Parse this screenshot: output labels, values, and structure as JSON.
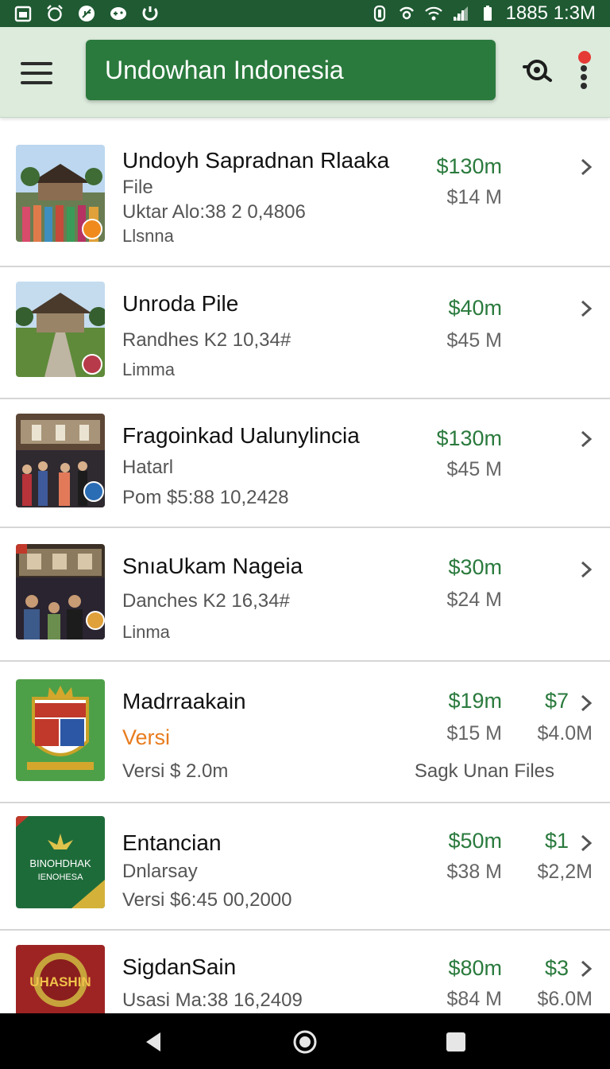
{
  "status_bar": {
    "time": "1885 1:3M",
    "icons": [
      "calendar-icon",
      "alarm-icon",
      "leaf-icon",
      "gamepad-icon",
      "refresh-icon"
    ],
    "right_icons": [
      "vibrate-icon",
      "hotspot-icon",
      "wifi-icon",
      "signal-icon",
      "battery-icon"
    ]
  },
  "app_bar": {
    "title": "Undowhan Indonesia",
    "icons": [
      "menu-icon",
      "search-icon",
      "more-vert-icon"
    ],
    "notification_color": "#e53935"
  },
  "colors": {
    "accent": "#2a7a3d",
    "status_bar": "#1f5a32",
    "app_bar": "#dcebdc",
    "secondary_text": "#e87c1e"
  },
  "items": [
    {
      "title": "Undoyh Sapradnan Rlaaka",
      "line1": "File",
      "line2": "Uktar Alo:38 2 0,4806",
      "line3": "Llsnna",
      "price_main": "$130m",
      "price_sub": "$14 M"
    },
    {
      "title": "Unroda Pile",
      "line1": "Randhes K2 10,34#",
      "line2": "Limma",
      "price_main": "$40m",
      "price_sub": "$45 M"
    },
    {
      "title": "Fragoinkad Ualunylincia",
      "line1": "Hatarl",
      "line2": "Pom  $5:88 10,2428",
      "price_main": "$130m",
      "price_sub": "$45 M"
    },
    {
      "title": "SnıaUkam Nageia",
      "line1": "Danches K2 16,34#",
      "line2": "Linma",
      "price_main": "$30m",
      "price_sub": "$24 M"
    },
    {
      "title": "Madrraakain",
      "line1": "Versi",
      "line2": "Versi $ 2.0m",
      "price_main": "$19m",
      "price_sub": "$15 M",
      "price_alt": "$7",
      "price_alt_sub": "$4.0M",
      "side_note": "Sagk Unan Files"
    },
    {
      "title": "Entancian",
      "line1": "Dnlarsay",
      "line2": "Versi $6:45 00,2000",
      "price_main": "$50m",
      "price_sub": "$38 M",
      "price_alt": "$1",
      "price_alt_sub": "$2,2M",
      "logo_text": [
        "BINOHDHAK",
        "IENOHESA"
      ]
    },
    {
      "title": "SigdanSain",
      "line1": "Usasi Ma:38 16,2409",
      "price_main": "$80m",
      "price_sub": "$84 M",
      "price_alt": "$3",
      "price_alt_sub": "$6.0M",
      "logo_text": [
        "UHASHIN"
      ]
    }
  ],
  "nav_bar": {
    "icons": [
      "back-icon",
      "home-icon",
      "recents-icon"
    ]
  }
}
